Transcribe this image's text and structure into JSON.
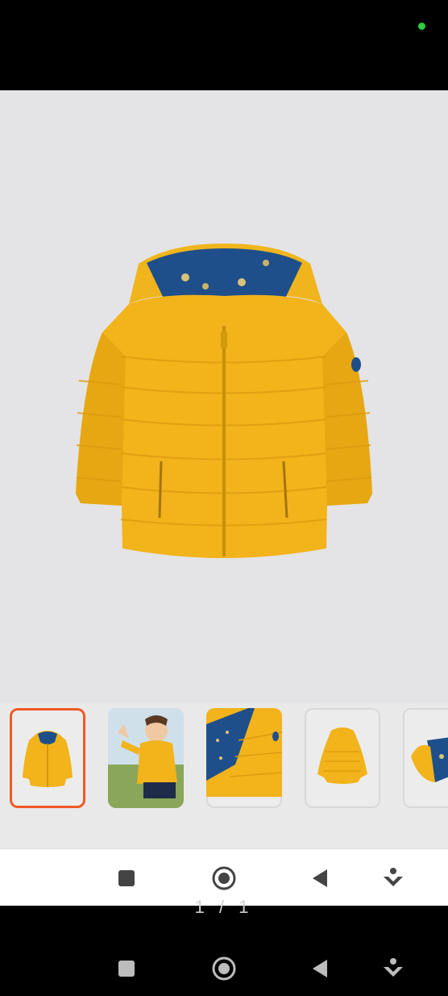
{
  "status": {
    "indicator_color": "#2ecc40"
  },
  "viewer": {
    "image_name": "yellow-puffer-jacket-image",
    "accent": "#f2b31b",
    "lining_color": "#1f4f8a"
  },
  "thumbnails": [
    {
      "name": "jacket-front",
      "selected": true
    },
    {
      "name": "child-wearing-jacket",
      "selected": false
    },
    {
      "name": "jacket-lining-detail",
      "selected": false
    },
    {
      "name": "jacket-back",
      "selected": false
    },
    {
      "name": "jacket-packed-pouch",
      "selected": false
    }
  ],
  "selection_color": "#ee5a24",
  "inner_nav": {
    "icons": [
      "stop-square-icon",
      "record-circle-icon",
      "back-triangle-icon",
      "download-arrow-icon"
    ]
  },
  "page_indicator": "1 / 1",
  "system_nav": {
    "icons": [
      "stop-square-icon",
      "record-circle-icon",
      "back-triangle-icon",
      "download-arrow-icon"
    ]
  }
}
